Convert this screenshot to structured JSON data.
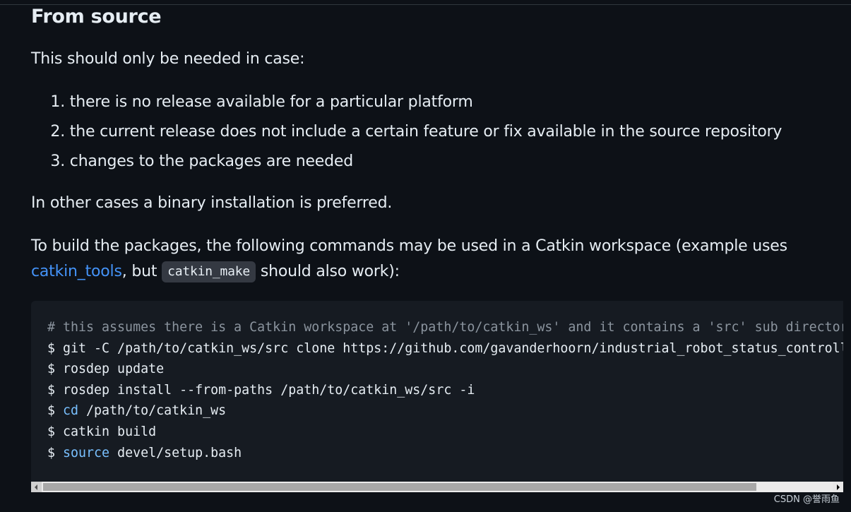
{
  "section": {
    "heading": "From source",
    "intro": "This should only be needed in case:",
    "reasons": [
      {
        "num": "1.",
        "text": "there is no release available for a particular platform"
      },
      {
        "num": "2.",
        "text": "the current release does not include a certain feature or fix available in the source repository"
      },
      {
        "num": "3.",
        "text": "changes to the packages are needed"
      }
    ],
    "other_cases": "In other cases a binary installation is preferred.",
    "build_text_1": "To build the packages, the following commands may be used in a Catkin workspace (example uses",
    "build_link": "catkin_tools",
    "build_text_2": ", but ",
    "build_inline_code": "catkin_make",
    "build_text_3": " should also work):"
  },
  "code": {
    "comment": "# this assumes there is a Catkin workspace at '/path/to/catkin_ws' and it contains a 'src' sub directory",
    "prompt": "$ ",
    "line2": "git -C /path/to/catkin_ws/src clone https://github.com/gavanderhoorn/industrial_robot_status_controller",
    "line3": "rosdep update",
    "line4": "rosdep install --from-paths /path/to/catkin_ws/src -i",
    "line5_cmd": "cd",
    "line5_rest": " /path/to/catkin_ws",
    "line6": "catkin build",
    "line7_cmd": "source",
    "line7_rest": " devel/setup.bash"
  },
  "watermark": "CSDN @誉雨鱼",
  "colors": {
    "background": "#0d1117",
    "code_background": "#161b22",
    "link": "#4493f8",
    "comment": "#8b949e",
    "builtin": "#79c0ff"
  }
}
